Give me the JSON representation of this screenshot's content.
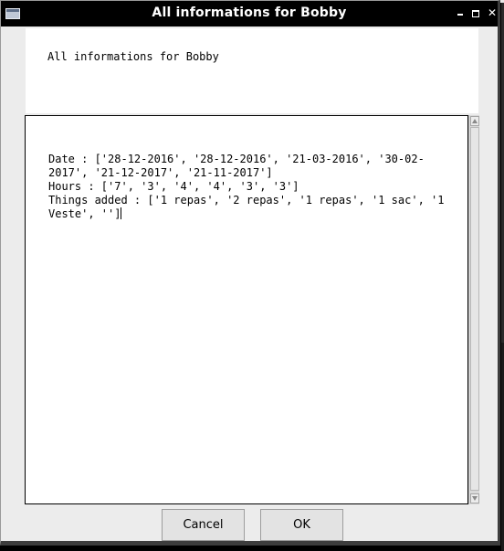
{
  "window": {
    "title": "All informations for Bobby"
  },
  "header": {
    "text": "All informations for Bobby"
  },
  "details": {
    "text": "Date : ['28-12-2016', '28-12-2016', '21-03-2016', '30-02-2017', '21-12-2017', '21-11-2017']\nHours : ['7', '3', '4', '4', '3', '3']\nThings added : ['1 repas', '2 repas', '1 repas', '1 sac', '1 Veste', '']"
  },
  "buttons": {
    "cancel_label": "Cancel",
    "ok_label": "OK"
  },
  "icons": {
    "window": "window-icon",
    "minimize": "minimize-icon",
    "maximize": "maximize-icon",
    "close": "close-icon"
  },
  "colors": {
    "titlebar": "#000000",
    "dialog_background": "#ececec",
    "panel_background": "#ffffff",
    "button_background": "#e3e3e3"
  }
}
